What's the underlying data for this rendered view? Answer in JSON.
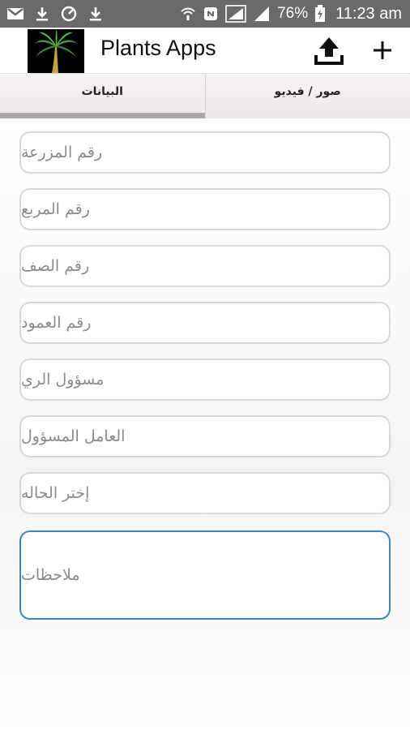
{
  "status_bar": {
    "battery": "76%",
    "time": "11:23 am"
  },
  "app": {
    "title": "Plants Apps"
  },
  "tabs": [
    {
      "label": "صور / فيديو",
      "active": false
    },
    {
      "label": "البيانات",
      "active": true
    }
  ],
  "form": {
    "fields": [
      {
        "placeholder": "رقم المزرعة"
      },
      {
        "placeholder": "رقم المربع"
      },
      {
        "placeholder": "رقم الصف"
      },
      {
        "placeholder": "رقم العمود"
      },
      {
        "placeholder": "مسؤول الري"
      },
      {
        "placeholder": "العامل المسؤول"
      },
      {
        "placeholder": "إختر الحاله"
      }
    ],
    "notes": {
      "placeholder": "ملاحظات"
    }
  },
  "colors": {
    "status_bar": "#6a6a6a",
    "field_border": "#d8d8d8",
    "focused_border": "#3b86c8",
    "tab_indicator": "#a9a9a9"
  },
  "icons": [
    "gmail-icon",
    "download-icon",
    "sync-icon",
    "download-icon",
    "wifi-icon",
    "nfc-icon",
    "signal-icon",
    "signal-icon",
    "battery-charging-icon",
    "palm-tree-logo",
    "upload-icon",
    "plus-icon"
  ]
}
